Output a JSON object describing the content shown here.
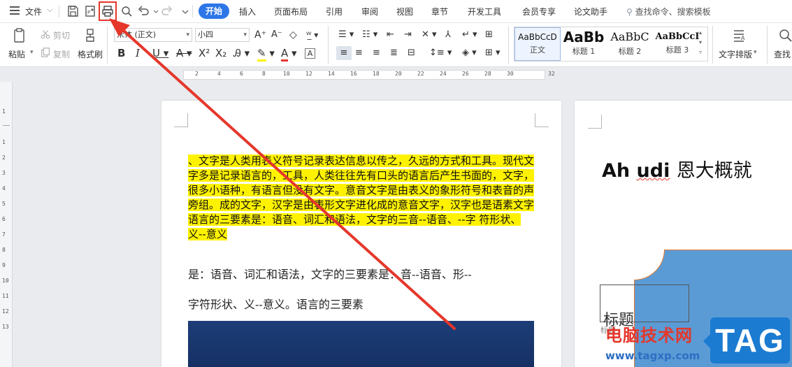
{
  "menubar": {
    "file_label": "文件",
    "tabs": [
      "开始",
      "插入",
      "页面布局",
      "引用",
      "审阅",
      "视图",
      "章节",
      "开发工具",
      "会员专享",
      "论文助手"
    ],
    "active_tab": "开始",
    "search_placeholder": "查找命令、搜索模板"
  },
  "ribbon": {
    "paste_label": "粘贴",
    "cut_label": "剪切",
    "copy_label": "复制",
    "format_painter_label": "格式刷",
    "font_name": "宋体 (正文)",
    "font_size": "小四",
    "styles": [
      {
        "sample": "AaBbCcD",
        "name": "正文"
      },
      {
        "sample": "AaBb",
        "name": "标题 1"
      },
      {
        "sample": "AaBbC",
        "name": "标题 2"
      },
      {
        "sample": "AaBbCcI",
        "name": "标题 3"
      }
    ],
    "text_layout_label": "文字排版",
    "find_replace_label": "查找"
  },
  "ruler": {
    "h_ticks": [
      "2",
      "4",
      "6",
      "8",
      "10",
      "12",
      "14",
      "16",
      "18",
      "20",
      "22",
      "24",
      "26",
      "28",
      "30",
      "32"
    ],
    "v_ticks": [
      "1",
      "1",
      "2",
      "3",
      "4",
      "5",
      "6",
      "7",
      "8",
      "9",
      "10",
      "11",
      "12",
      "13"
    ]
  },
  "page1": {
    "highlighted_text": "、文字是人类用表义符号记录表达信息以传之，久远的方式和工具。现代文字多是记录语言的，工具，人类往往先有口头的语言后产生书面的，文字，很多小语种，有语言但没有文字。意音文字是由表义的象形符号和表音的声旁组。成的文字，汉字是由表形文字进化成的意音文字，汉字也是语素文字语言的三要素是：语音、词汇和语法，文字的三音--语音、--字  符形状、义--意义",
    "line1": "是：语音、词汇和语法，文字的三要素是：音--语音、形--",
    "line2": "字符形状、义--意义。语言的三要素"
  },
  "page2": {
    "title_latin_a": "Ah",
    "title_latin_b": "udi",
    "title_cjk": "恩大概就",
    "textbox_label": "标题",
    "textbox_sub": "标题"
  },
  "watermark": {
    "site_name": "电脑技术网",
    "url": "www.tagxp.com",
    "tag": "TAG"
  },
  "colors": {
    "accent": "#2c76e8",
    "highlight": "#fff200",
    "annotation_red": "#e5372b",
    "shape_blue": "#5b9bd5"
  }
}
